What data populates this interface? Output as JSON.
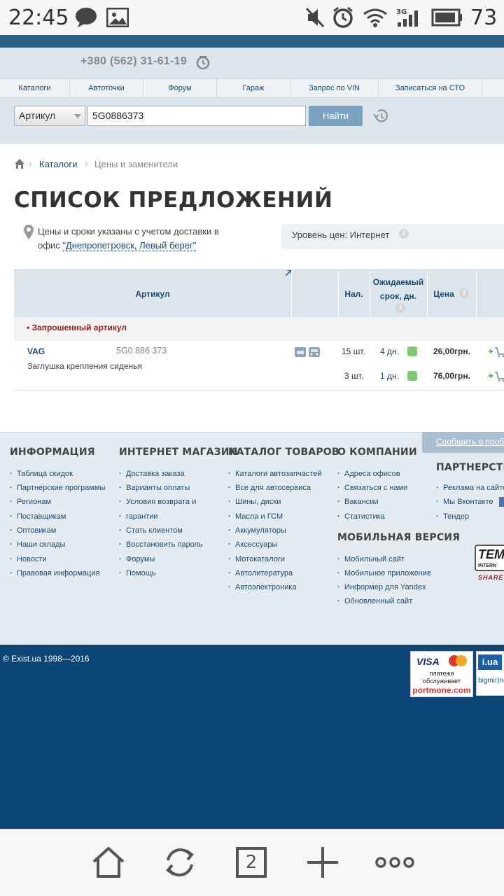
{
  "status_bar": {
    "time": "22:45",
    "battery": "73"
  },
  "header": {
    "phone": "+380 (562) 31-61-19"
  },
  "nav": [
    "Каталоги",
    "Автоточки",
    "Форум",
    "Гараж",
    "Запрос по VIN",
    "Записаться на СТО"
  ],
  "search": {
    "type_label": "Артикул",
    "query": "5G0886373",
    "button": "Найти"
  },
  "breadcrumbs": {
    "catalogs": "Каталоги",
    "current": "Цены и заменители"
  },
  "page_title": "СПИСОК ПРЕДЛОЖЕНИЙ",
  "delivery_note": {
    "text": "Цены и сроки указаны с учетом доставки в офис ",
    "office": "\"Днепропетровск, Левый берег\""
  },
  "price_level": {
    "label": "Уровень цен: Интернет"
  },
  "table": {
    "headers": {
      "article": "Артикул",
      "stock": "Нал.",
      "term": "Ожидаемый срок, дн.",
      "price": "Цена"
    },
    "requested_label": "• Запрошенный артикул",
    "item": {
      "brand": "VAG",
      "article": "5G0 886 373",
      "description": "Заглушка крепления сиденья",
      "offers": [
        {
          "qty": "15 шт.",
          "term": "4 дн.",
          "price": "26,00грн."
        },
        {
          "qty": "3 шт.",
          "term": "1 дн.",
          "price": "76,00грн."
        }
      ]
    }
  },
  "footer": {
    "report": "Сообщить о проблеме",
    "columns": [
      {
        "title": "ИНФОРМАЦИЯ",
        "links": [
          "Таблица скидок",
          "Партнерские программы",
          "Регионам",
          "Поставщикам",
          "Оптовикам",
          "Наши склады",
          "Новости",
          "Правовая информация"
        ]
      },
      {
        "title": "ИНТЕРНЕТ МАГАЗИН",
        "links": [
          "Доставка заказа",
          "Варианты оплаты",
          "Условия возврата и",
          "гарантии",
          "Стать клиентом",
          "Восстановить пароль",
          "Форумы",
          "Помощь"
        ]
      },
      {
        "title": "КАТАЛОГ ТОВАРОВ",
        "links": [
          "Каталоги автозапчастей",
          "Все для автосервиса",
          "Шины, диски",
          "Масла и ГСМ",
          "Аккумуляторы",
          "Аксессуары",
          "Мотокаталоги",
          "Автолитература",
          "Автоэлектроника"
        ]
      },
      {
        "title": "О КОМПАНИИ",
        "links": [
          "Адреса офисов",
          "Связаться с нами",
          "Вакансии",
          "Статистика"
        ]
      },
      {
        "title": "МОБИЛЬНАЯ ВЕРСИЯ",
        "links": [
          "Мобильный сайт",
          "Мобильное приложение",
          "Информер для Yandex",
          "Обновленный сайт"
        ]
      },
      {
        "title": "ПАРТНЕРСТВО",
        "links": [
          "Реклама на сайте",
          "Мы Вконтакте",
          "Тендер"
        ]
      }
    ],
    "copyright": "© Exist.ua 1998—2016",
    "payment": {
      "visa": "VISA",
      "line1": "платежи",
      "line2": "обслуживает",
      "brand": "portmone.com"
    },
    "iua": {
      "logo": "i.ua",
      "text": "bigmir)net"
    },
    "tem": {
      "logo": "TEM",
      "sub": "INTERN",
      "share": "SHARE"
    }
  },
  "browser": {
    "tabs": "2"
  }
}
